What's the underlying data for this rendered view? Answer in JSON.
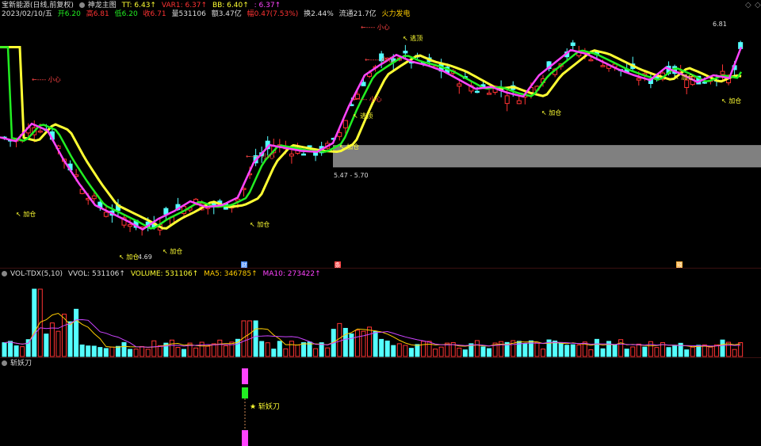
{
  "header": {
    "stock_name": "宝新能源(日线,前复权)",
    "indicator_name": "神龙主图",
    "tt": "TT: 6.43↑",
    "var1": "VAR1: 6.37↑",
    "bb": "BB: 6.40↑",
    "extra": ": 6.37↑",
    "colors": {
      "tt": "#ffff33",
      "var1": "#ff3333",
      "bb": "#ffff33",
      "extra": "#ff44ff"
    }
  },
  "info": {
    "date": "2023/02/10/五",
    "open": "开6.20",
    "high": "高6.81",
    "low": "低6.20",
    "close": "收6.71",
    "volume": "量531106",
    "amount": "额3.47亿",
    "change": "幅0.47(7.53%)",
    "turnover": "换2.44%",
    "float": "流通21.7亿",
    "sector": "火力发电"
  },
  "vol_panel": {
    "name": "VOL-TDX(5,10)",
    "vvol": "VVOL: 531106↑",
    "volume": "VOLUME: 531106↑",
    "ma5": "MA5: 346785↑",
    "ma10": "MA10: 273422↑"
  },
  "knife_panel": {
    "name": "斩妖刀",
    "signal_label": "★ 斩妖刀"
  },
  "annotations": {
    "add": "加仓",
    "careful": "小心",
    "escape": "逃顶",
    "price_high": "6.81",
    "price_low": "4.69",
    "band_range": "5.47 - 5.70",
    "markers": [
      "财",
      "条",
      "预"
    ]
  },
  "colors": {
    "up": "#ff3333",
    "down": "#54ffff",
    "ma_yellow": "#ffff33",
    "green_line": "#22ee22",
    "magenta": "#ff44ff",
    "band": "#808080"
  }
}
